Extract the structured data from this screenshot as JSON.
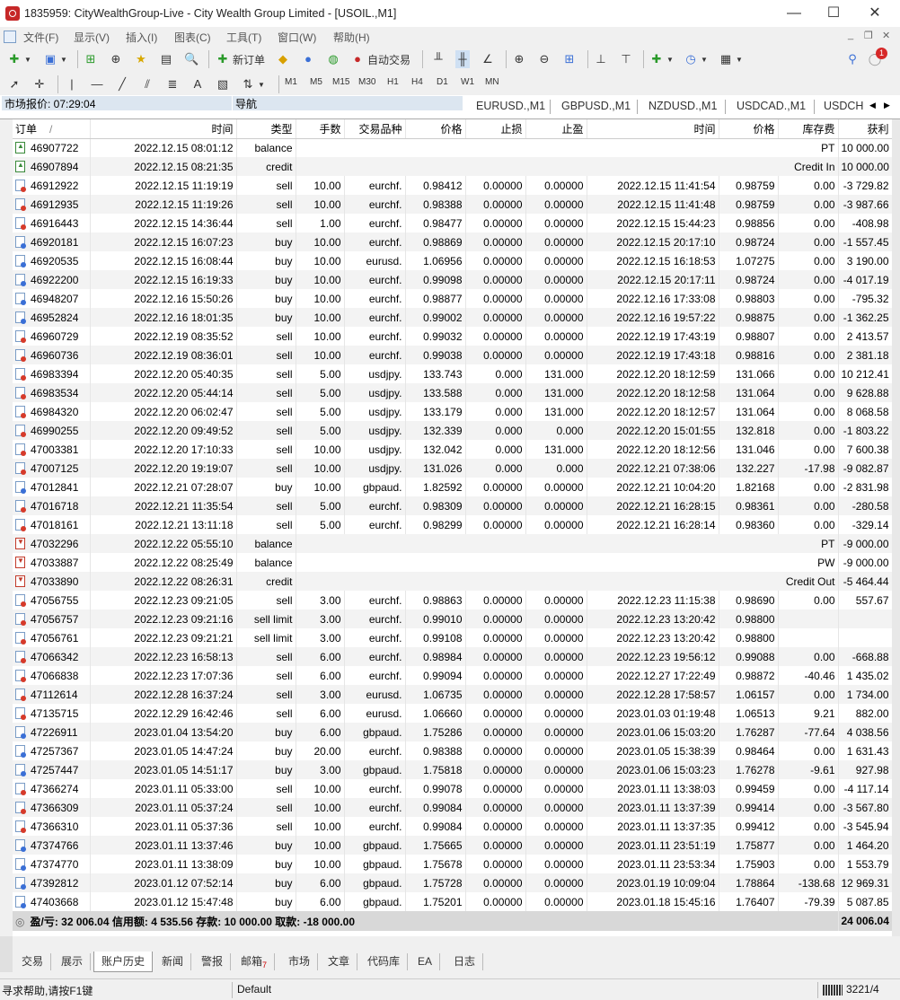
{
  "window": {
    "title": "1835959: CityWealthGroup-Live - City Wealth Group Limited - [USOIL.,M1]",
    "minimize": "—",
    "maximize": "☐",
    "close": "✕"
  },
  "menu": {
    "items": [
      "文件(F)",
      "显示(V)",
      "插入(I)",
      "图表(C)",
      "工具(T)",
      "窗口(W)",
      "帮助(H)"
    ],
    "mdi_min": "_",
    "mdi_restore": "❐",
    "mdi_close": "✕"
  },
  "toolbar": {
    "new_order": "新订单",
    "autotrade": "自动交易",
    "notification_count": "1"
  },
  "timeframes": [
    "M1",
    "M5",
    "M15",
    "M30",
    "H1",
    "H4",
    "D1",
    "W1",
    "MN"
  ],
  "panels": {
    "market_watch": "市场报价: 07:29:04",
    "navigator": "导航"
  },
  "symbol_tabs": [
    "EURUSD.,M1",
    "GBPUSD.,M1",
    "NZDUSD.,M1",
    "USDCAD.,M1",
    "USDCH"
  ],
  "history": {
    "columns": [
      "订单",
      "时间",
      "类型",
      "手数",
      "交易品种",
      "价格",
      "止损",
      "止盈",
      "时间",
      "价格",
      "库存费",
      "获利"
    ],
    "sort_indicator": "/",
    "rows": [
      {
        "order": "46907722",
        "time": "2022.12.15 08:01:12",
        "type": "balance",
        "comment": "PT",
        "profit": "10 000.00"
      },
      {
        "order": "46907894",
        "time": "2022.12.15 08:21:35",
        "type": "credit",
        "comment": "Credit In",
        "profit": "10 000.00"
      },
      {
        "order": "46912922",
        "time": "2022.12.15 11:19:19",
        "type": "sell",
        "lots": "10.00",
        "symbol": "eurchf.",
        "price": "0.98412",
        "sl": "0.00000",
        "tp": "0.00000",
        "ctime": "2022.12.15 11:41:54",
        "cprice": "0.98759",
        "swap": "0.00",
        "profit": "-3 729.82"
      },
      {
        "order": "46912935",
        "time": "2022.12.15 11:19:26",
        "type": "sell",
        "lots": "10.00",
        "symbol": "eurchf.",
        "price": "0.98388",
        "sl": "0.00000",
        "tp": "0.00000",
        "ctime": "2022.12.15 11:41:48",
        "cprice": "0.98759",
        "swap": "0.00",
        "profit": "-3 987.66"
      },
      {
        "order": "46916443",
        "time": "2022.12.15 14:36:44",
        "type": "sell",
        "lots": "1.00",
        "symbol": "eurchf.",
        "price": "0.98477",
        "sl": "0.00000",
        "tp": "0.00000",
        "ctime": "2022.12.15 15:44:23",
        "cprice": "0.98856",
        "swap": "0.00",
        "profit": "-408.98"
      },
      {
        "order": "46920181",
        "time": "2022.12.15 16:07:23",
        "type": "buy",
        "lots": "10.00",
        "symbol": "eurchf.",
        "price": "0.98869",
        "sl": "0.00000",
        "tp": "0.00000",
        "ctime": "2022.12.15 20:17:10",
        "cprice": "0.98724",
        "swap": "0.00",
        "profit": "-1 557.45"
      },
      {
        "order": "46920535",
        "time": "2022.12.15 16:08:44",
        "type": "buy",
        "lots": "10.00",
        "symbol": "eurusd.",
        "price": "1.06956",
        "sl": "0.00000",
        "tp": "0.00000",
        "ctime": "2022.12.15 16:18:53",
        "cprice": "1.07275",
        "swap": "0.00",
        "profit": "3 190.00"
      },
      {
        "order": "46922200",
        "time": "2022.12.15 16:19:33",
        "type": "buy",
        "lots": "10.00",
        "symbol": "eurchf.",
        "price": "0.99098",
        "sl": "0.00000",
        "tp": "0.00000",
        "ctime": "2022.12.15 20:17:11",
        "cprice": "0.98724",
        "swap": "0.00",
        "profit": "-4 017.19"
      },
      {
        "order": "46948207",
        "time": "2022.12.16 15:50:26",
        "type": "buy",
        "lots": "10.00",
        "symbol": "eurchf.",
        "price": "0.98877",
        "sl": "0.00000",
        "tp": "0.00000",
        "ctime": "2022.12.16 17:33:08",
        "cprice": "0.98803",
        "swap": "0.00",
        "profit": "-795.32"
      },
      {
        "order": "46952824",
        "time": "2022.12.16 18:01:35",
        "type": "buy",
        "lots": "10.00",
        "symbol": "eurchf.",
        "price": "0.99002",
        "sl": "0.00000",
        "tp": "0.00000",
        "ctime": "2022.12.16 19:57:22",
        "cprice": "0.98875",
        "swap": "0.00",
        "profit": "-1 362.25"
      },
      {
        "order": "46960729",
        "time": "2022.12.19 08:35:52",
        "type": "sell",
        "lots": "10.00",
        "symbol": "eurchf.",
        "price": "0.99032",
        "sl": "0.00000",
        "tp": "0.00000",
        "ctime": "2022.12.19 17:43:19",
        "cprice": "0.98807",
        "swap": "0.00",
        "profit": "2 413.57"
      },
      {
        "order": "46960736",
        "time": "2022.12.19 08:36:01",
        "type": "sell",
        "lots": "10.00",
        "symbol": "eurchf.",
        "price": "0.99038",
        "sl": "0.00000",
        "tp": "0.00000",
        "ctime": "2022.12.19 17:43:18",
        "cprice": "0.98816",
        "swap": "0.00",
        "profit": "2 381.18"
      },
      {
        "order": "46983394",
        "time": "2022.12.20 05:40:35",
        "type": "sell",
        "lots": "5.00",
        "symbol": "usdjpy.",
        "price": "133.743",
        "sl": "0.000",
        "tp": "131.000",
        "ctime": "2022.12.20 18:12:59",
        "cprice": "131.066",
        "swap": "0.00",
        "profit": "10 212.41"
      },
      {
        "order": "46983534",
        "time": "2022.12.20 05:44:14",
        "type": "sell",
        "lots": "5.00",
        "symbol": "usdjpy.",
        "price": "133.588",
        "sl": "0.000",
        "tp": "131.000",
        "ctime": "2022.12.20 18:12:58",
        "cprice": "131.064",
        "swap": "0.00",
        "profit": "9 628.88"
      },
      {
        "order": "46984320",
        "time": "2022.12.20 06:02:47",
        "type": "sell",
        "lots": "5.00",
        "symbol": "usdjpy.",
        "price": "133.179",
        "sl": "0.000",
        "tp": "131.000",
        "ctime": "2022.12.20 18:12:57",
        "cprice": "131.064",
        "swap": "0.00",
        "profit": "8 068.58"
      },
      {
        "order": "46990255",
        "time": "2022.12.20 09:49:52",
        "type": "sell",
        "lots": "5.00",
        "symbol": "usdjpy.",
        "price": "132.339",
        "sl": "0.000",
        "tp": "0.000",
        "ctime": "2022.12.20 15:01:55",
        "cprice": "132.818",
        "swap": "0.00",
        "profit": "-1 803.22"
      },
      {
        "order": "47003381",
        "time": "2022.12.20 17:10:33",
        "type": "sell",
        "lots": "10.00",
        "symbol": "usdjpy.",
        "price": "132.042",
        "sl": "0.000",
        "tp": "131.000",
        "ctime": "2022.12.20 18:12:56",
        "cprice": "131.046",
        "swap": "0.00",
        "profit": "7 600.38"
      },
      {
        "order": "47007125",
        "time": "2022.12.20 19:19:07",
        "type": "sell",
        "lots": "10.00",
        "symbol": "usdjpy.",
        "price": "131.026",
        "sl": "0.000",
        "tp": "0.000",
        "ctime": "2022.12.21 07:38:06",
        "cprice": "132.227",
        "swap": "-17.98",
        "profit": "-9 082.87"
      },
      {
        "order": "47012841",
        "time": "2022.12.21 07:28:07",
        "type": "buy",
        "lots": "10.00",
        "symbol": "gbpaud.",
        "price": "1.82592",
        "sl": "0.00000",
        "tp": "0.00000",
        "ctime": "2022.12.21 10:04:20",
        "cprice": "1.82168",
        "swap": "0.00",
        "profit": "-2 831.98"
      },
      {
        "order": "47016718",
        "time": "2022.12.21 11:35:54",
        "type": "sell",
        "lots": "5.00",
        "symbol": "eurchf.",
        "price": "0.98309",
        "sl": "0.00000",
        "tp": "0.00000",
        "ctime": "2022.12.21 16:28:15",
        "cprice": "0.98361",
        "swap": "0.00",
        "profit": "-280.58"
      },
      {
        "order": "47018161",
        "time": "2022.12.21 13:11:18",
        "type": "sell",
        "lots": "5.00",
        "symbol": "eurchf.",
        "price": "0.98299",
        "sl": "0.00000",
        "tp": "0.00000",
        "ctime": "2022.12.21 16:28:14",
        "cprice": "0.98360",
        "swap": "0.00",
        "profit": "-329.14"
      },
      {
        "order": "47032296",
        "time": "2022.12.22 05:55:10",
        "type": "balance",
        "comment": "PT",
        "profit": "-9 000.00"
      },
      {
        "order": "47033887",
        "time": "2022.12.22 08:25:49",
        "type": "balance",
        "comment": "PW",
        "profit": "-9 000.00"
      },
      {
        "order": "47033890",
        "time": "2022.12.22 08:26:31",
        "type": "credit",
        "comment": "Credit Out",
        "profit": "-5 464.44"
      },
      {
        "order": "47056755",
        "time": "2022.12.23 09:21:05",
        "type": "sell",
        "lots": "3.00",
        "symbol": "eurchf.",
        "price": "0.98863",
        "sl": "0.00000",
        "tp": "0.00000",
        "ctime": "2022.12.23 11:15:38",
        "cprice": "0.98690",
        "swap": "0.00",
        "profit": "557.67"
      },
      {
        "order": "47056757",
        "time": "2022.12.23 09:21:16",
        "type": "sell limit",
        "lots": "3.00",
        "symbol": "eurchf.",
        "price": "0.99010",
        "sl": "0.00000",
        "tp": "0.00000",
        "ctime": "2022.12.23 13:20:42",
        "cprice": "0.98800",
        "swap": "",
        "profit": ""
      },
      {
        "order": "47056761",
        "time": "2022.12.23 09:21:21",
        "type": "sell limit",
        "lots": "3.00",
        "symbol": "eurchf.",
        "price": "0.99108",
        "sl": "0.00000",
        "tp": "0.00000",
        "ctime": "2022.12.23 13:20:42",
        "cprice": "0.98800",
        "swap": "",
        "profit": ""
      },
      {
        "order": "47066342",
        "time": "2022.12.23 16:58:13",
        "type": "sell",
        "lots": "6.00",
        "symbol": "eurchf.",
        "price": "0.98984",
        "sl": "0.00000",
        "tp": "0.00000",
        "ctime": "2022.12.23 19:56:12",
        "cprice": "0.99088",
        "swap": "0.00",
        "profit": "-668.88"
      },
      {
        "order": "47066838",
        "time": "2022.12.23 17:07:36",
        "type": "sell",
        "lots": "6.00",
        "symbol": "eurchf.",
        "price": "0.99094",
        "sl": "0.00000",
        "tp": "0.00000",
        "ctime": "2022.12.27 17:22:49",
        "cprice": "0.98872",
        "swap": "-40.46",
        "profit": "1 435.02"
      },
      {
        "order": "47112614",
        "time": "2022.12.28 16:37:24",
        "type": "sell",
        "lots": "3.00",
        "symbol": "eurusd.",
        "price": "1.06735",
        "sl": "0.00000",
        "tp": "0.00000",
        "ctime": "2022.12.28 17:58:57",
        "cprice": "1.06157",
        "swap": "0.00",
        "profit": "1 734.00"
      },
      {
        "order": "47135715",
        "time": "2022.12.29 16:42:46",
        "type": "sell",
        "lots": "6.00",
        "symbol": "eurusd.",
        "price": "1.06660",
        "sl": "0.00000",
        "tp": "0.00000",
        "ctime": "2023.01.03 01:19:48",
        "cprice": "1.06513",
        "swap": "9.21",
        "profit": "882.00"
      },
      {
        "order": "47226911",
        "time": "2023.01.04 13:54:20",
        "type": "buy",
        "lots": "6.00",
        "symbol": "gbpaud.",
        "price": "1.75286",
        "sl": "0.00000",
        "tp": "0.00000",
        "ctime": "2023.01.06 15:03:20",
        "cprice": "1.76287",
        "swap": "-77.64",
        "profit": "4 038.56"
      },
      {
        "order": "47257367",
        "time": "2023.01.05 14:47:24",
        "type": "buy",
        "lots": "20.00",
        "symbol": "eurchf.",
        "price": "0.98388",
        "sl": "0.00000",
        "tp": "0.00000",
        "ctime": "2023.01.05 15:38:39",
        "cprice": "0.98464",
        "swap": "0.00",
        "profit": "1 631.43"
      },
      {
        "order": "47257447",
        "time": "2023.01.05 14:51:17",
        "type": "buy",
        "lots": "3.00",
        "symbol": "gbpaud.",
        "price": "1.75818",
        "sl": "0.00000",
        "tp": "0.00000",
        "ctime": "2023.01.06 15:03:23",
        "cprice": "1.76278",
        "swap": "-9.61",
        "profit": "927.98"
      },
      {
        "order": "47366274",
        "time": "2023.01.11 05:33:00",
        "type": "sell",
        "lots": "10.00",
        "symbol": "eurchf.",
        "price": "0.99078",
        "sl": "0.00000",
        "tp": "0.00000",
        "ctime": "2023.01.11 13:38:03",
        "cprice": "0.99459",
        "swap": "0.00",
        "profit": "-4 117.14"
      },
      {
        "order": "47366309",
        "time": "2023.01.11 05:37:24",
        "type": "sell",
        "lots": "10.00",
        "symbol": "eurchf.",
        "price": "0.99084",
        "sl": "0.00000",
        "tp": "0.00000",
        "ctime": "2023.01.11 13:37:39",
        "cprice": "0.99414",
        "swap": "0.00",
        "profit": "-3 567.80"
      },
      {
        "order": "47366310",
        "time": "2023.01.11 05:37:36",
        "type": "sell",
        "lots": "10.00",
        "symbol": "eurchf.",
        "price": "0.99084",
        "sl": "0.00000",
        "tp": "0.00000",
        "ctime": "2023.01.11 13:37:35",
        "cprice": "0.99412",
        "swap": "0.00",
        "profit": "-3 545.94"
      },
      {
        "order": "47374766",
        "time": "2023.01.11 13:37:46",
        "type": "buy",
        "lots": "10.00",
        "symbol": "gbpaud.",
        "price": "1.75665",
        "sl": "0.00000",
        "tp": "0.00000",
        "ctime": "2023.01.11 23:51:19",
        "cprice": "1.75877",
        "swap": "0.00",
        "profit": "1 464.20"
      },
      {
        "order": "47374770",
        "time": "2023.01.11 13:38:09",
        "type": "buy",
        "lots": "10.00",
        "symbol": "gbpaud.",
        "price": "1.75678",
        "sl": "0.00000",
        "tp": "0.00000",
        "ctime": "2023.01.11 23:53:34",
        "cprice": "1.75903",
        "swap": "0.00",
        "profit": "1 553.79"
      },
      {
        "order": "47392812",
        "time": "2023.01.12 07:52:14",
        "type": "buy",
        "lots": "6.00",
        "symbol": "gbpaud.",
        "price": "1.75728",
        "sl": "0.00000",
        "tp": "0.00000",
        "ctime": "2023.01.19 10:09:04",
        "cprice": "1.78864",
        "swap": "-138.68",
        "profit": "12 969.31"
      },
      {
        "order": "47403668",
        "time": "2023.01.12 15:47:48",
        "type": "buy",
        "lots": "6.00",
        "symbol": "gbpaud.",
        "price": "1.75201",
        "sl": "0.00000",
        "tp": "0.00000",
        "ctime": "2023.01.18 15:45:16",
        "cprice": "1.76407",
        "swap": "-79.39",
        "profit": "5 087.85"
      }
    ],
    "summary": {
      "text": "盈/亏: 32 006.04  信用额: 4 535.56  存款: 10 000.00  取款: -18 000.00",
      "total": "24 006.04"
    }
  },
  "bottom_tabs": [
    "交易",
    "展示",
    "账户历史",
    "新闻",
    "警报",
    "邮箱",
    "市场",
    "文章",
    "代码库",
    "EA",
    "日志"
  ],
  "bottom_tabs_active": "账户历史",
  "mail_badge": "7",
  "status": {
    "help": "寻求帮助,请按F1键",
    "profile": "Default",
    "connection": "3221/4"
  }
}
